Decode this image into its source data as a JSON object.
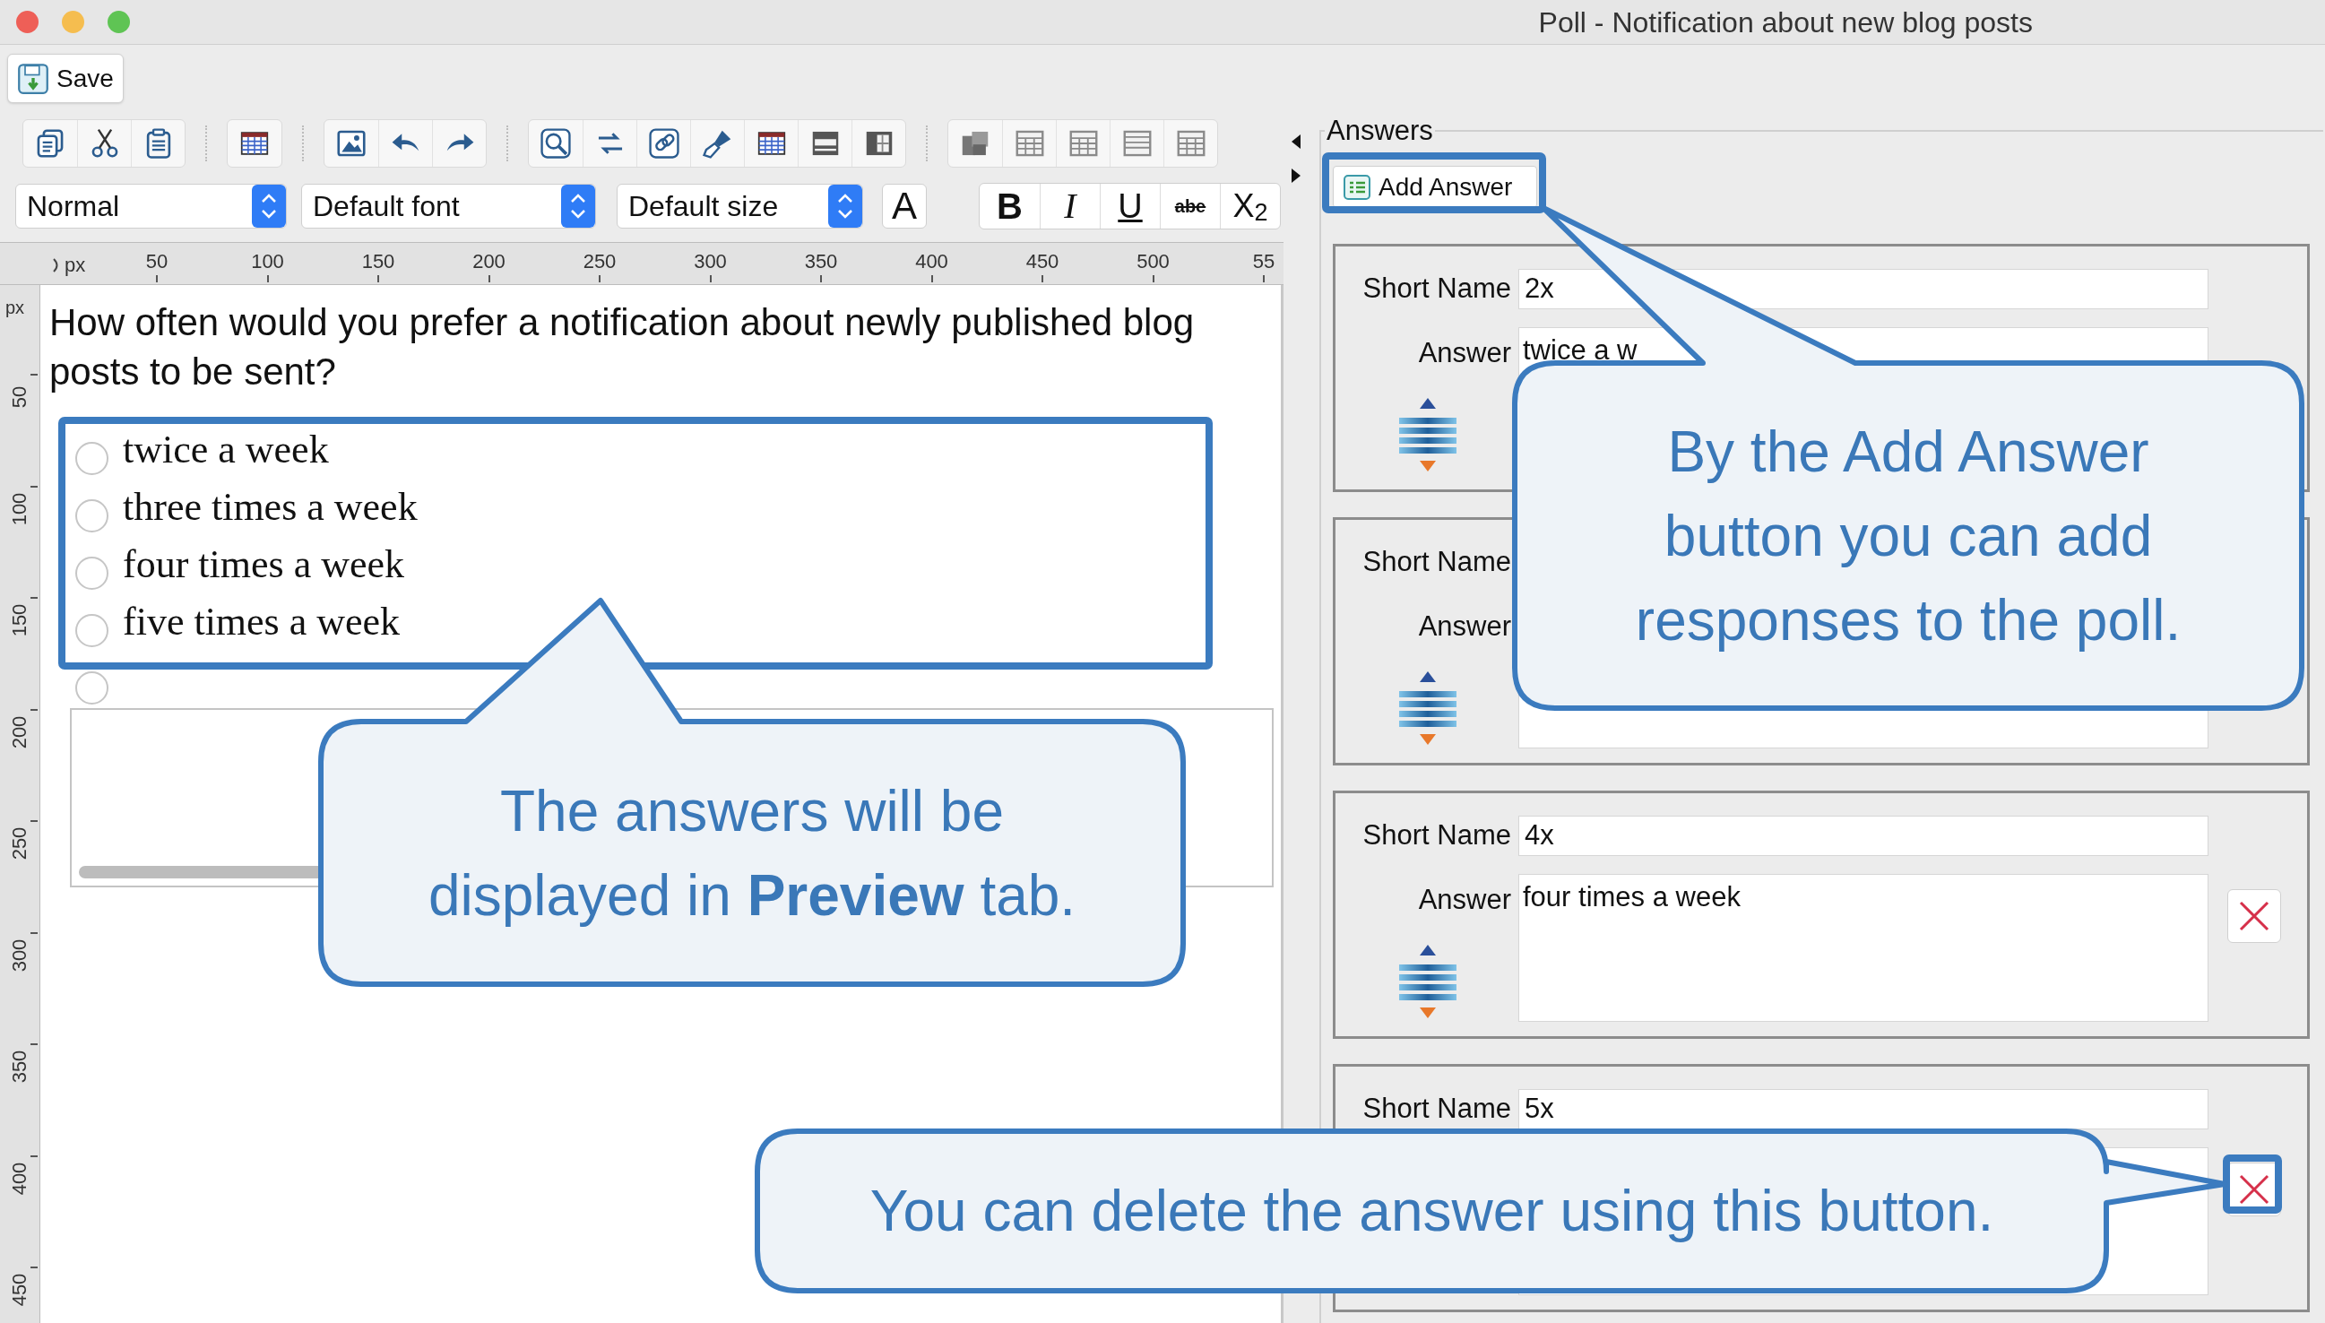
{
  "window": {
    "title": "Poll - Notification about new blog posts"
  },
  "toolbar": {
    "save": "Save"
  },
  "format_bar": {
    "paragraph_style": "Normal",
    "font": "Default font",
    "size": "Default size",
    "text_color": "A",
    "styles": [
      {
        "kind": "bold",
        "label": "B"
      },
      {
        "kind": "italic",
        "label": "I"
      },
      {
        "kind": "underline",
        "label": "U"
      },
      {
        "kind": "strikethrough",
        "label": "abe"
      },
      {
        "kind": "subscript",
        "label": "X$_{2}$"
      }
    ]
  },
  "ruler": {
    "unit": "px",
    "ticks": [
      "50",
      "100",
      "150",
      "200",
      "250",
      "300",
      "350",
      "400",
      "450",
      "500",
      "55"
    ]
  },
  "vertical_ruler": {
    "unit": "px",
    "ticks": [
      "50",
      "100",
      "150",
      "200",
      "250",
      "300",
      "350",
      "400",
      "450"
    ]
  },
  "editor": {
    "question": "How often would you prefer a notification about newly published blog posts to be sent?",
    "choices": [
      {
        "label": "twice a week",
        "selected": false
      },
      {
        "label": "three times a week",
        "selected": false
      },
      {
        "label": "four times a week",
        "selected": false
      },
      {
        "label": "five times a week",
        "selected": false
      },
      {
        "selected": false
      }
    ]
  },
  "answers_panel": {
    "title": "Answers",
    "add_button": "Add Answer",
    "answers": [
      {
        "short_name_label": "Short Name",
        "short_name": "2x",
        "answer_label": "Answer",
        "answer": "twice a w",
        "delete_button": false
      },
      {
        "short_name_label": "Short Name",
        "answer_label": "Answer",
        "delete_button": false
      },
      {
        "short_name_label": "Short Name",
        "short_name": "4x",
        "answer_label": "Answer",
        "answer": "four times a week",
        "delete_button": true
      },
      {
        "short_name_label": "Short Name",
        "short_name": "5x",
        "delete_button": true
      }
    ]
  },
  "callouts": [
    {
      "text": "The answers will be displayed in **Preview** tab."
    },
    {
      "text": "By the Add Answer button you can add responses to the poll."
    },
    {
      "text": "You can delete the answer using this button."
    }
  ]
}
